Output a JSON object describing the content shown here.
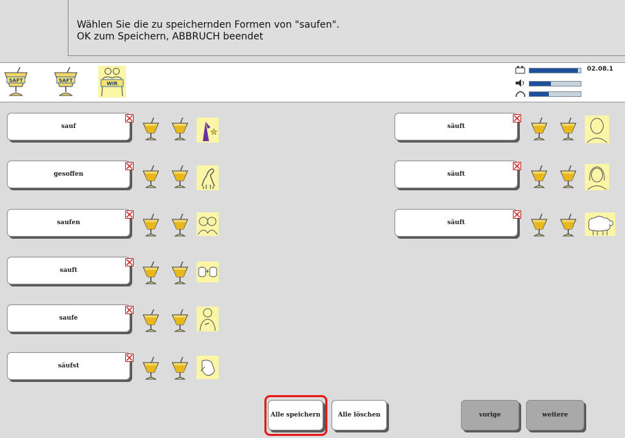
{
  "message": {
    "line1": "Wählen Sie die zu speichernden Formen von \"saufen\".",
    "line2": "OK zum Speichern, ABBRUCH beendet"
  },
  "symbol_bar": {
    "symbols": [
      {
        "label": "SAFT",
        "icon": "juice-glass-icon"
      },
      {
        "label": "SAFT",
        "icon": "juice-glass-icon"
      },
      {
        "label": "WIR",
        "icon": "people-we-icon"
      }
    ],
    "date": "02.08.1",
    "battery_level": 0.95,
    "volume_level": 0.42,
    "headphone_level": 0.38
  },
  "forms_left": [
    {
      "label": "sauf",
      "picto": "wizard-icon"
    },
    {
      "label": "gesoffen",
      "picto": "animal-drinking-icon"
    },
    {
      "label": "saufen",
      "picto": "two-people-icon"
    },
    {
      "label": "sauft",
      "picto": "pointing-hands-icon"
    },
    {
      "label": "saufe",
      "picto": "self-pointing-person-icon"
    },
    {
      "label": "säufst",
      "picto": "pointing-hand-icon"
    }
  ],
  "forms_right": [
    {
      "label": "säuft",
      "picto": "man-face-icon"
    },
    {
      "label": "säuft",
      "picto": "woman-face-icon"
    },
    {
      "label": "säuft",
      "picto": "sheep-icon"
    }
  ],
  "buttons": {
    "save_all": "Alle speichern",
    "delete_all": "Alle löschen",
    "previous": "vorige",
    "next": "weitere"
  },
  "colors": {
    "background": "#dcdcdc",
    "picto_bg": "#fbf6a6",
    "focus": "#e41b1b",
    "juice": "#e8b71c",
    "level_bar": "#1e4f9c"
  }
}
